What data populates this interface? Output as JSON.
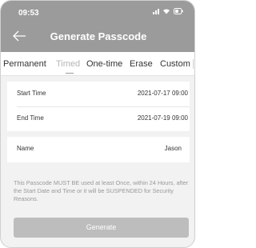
{
  "status_bar": {
    "time": "09:53"
  },
  "header": {
    "title": "Generate Passcode"
  },
  "tabs": [
    {
      "label": "Permanent"
    },
    {
      "label": "Timed"
    },
    {
      "label": "One-time"
    },
    {
      "label": "Erase"
    },
    {
      "label": "Custom"
    }
  ],
  "active_tab": "Timed",
  "form": {
    "start_time": {
      "label": "Start Time",
      "value": "2021-07-17 09:00"
    },
    "end_time": {
      "label": "End Time",
      "value": "2021-07-19 09:00"
    },
    "name": {
      "label": "Name",
      "value": "Jason"
    }
  },
  "notice": "This Passcode MUST BE used at least Once, within 24 Hours, after the Start Date and Time or it will be SUSPENDED for Security Reasons.",
  "generate_button": {
    "label": "Generate"
  },
  "colors": {
    "header": "#9b9b9b",
    "button": "#bdbdbd",
    "background": "#f2f2f2"
  }
}
